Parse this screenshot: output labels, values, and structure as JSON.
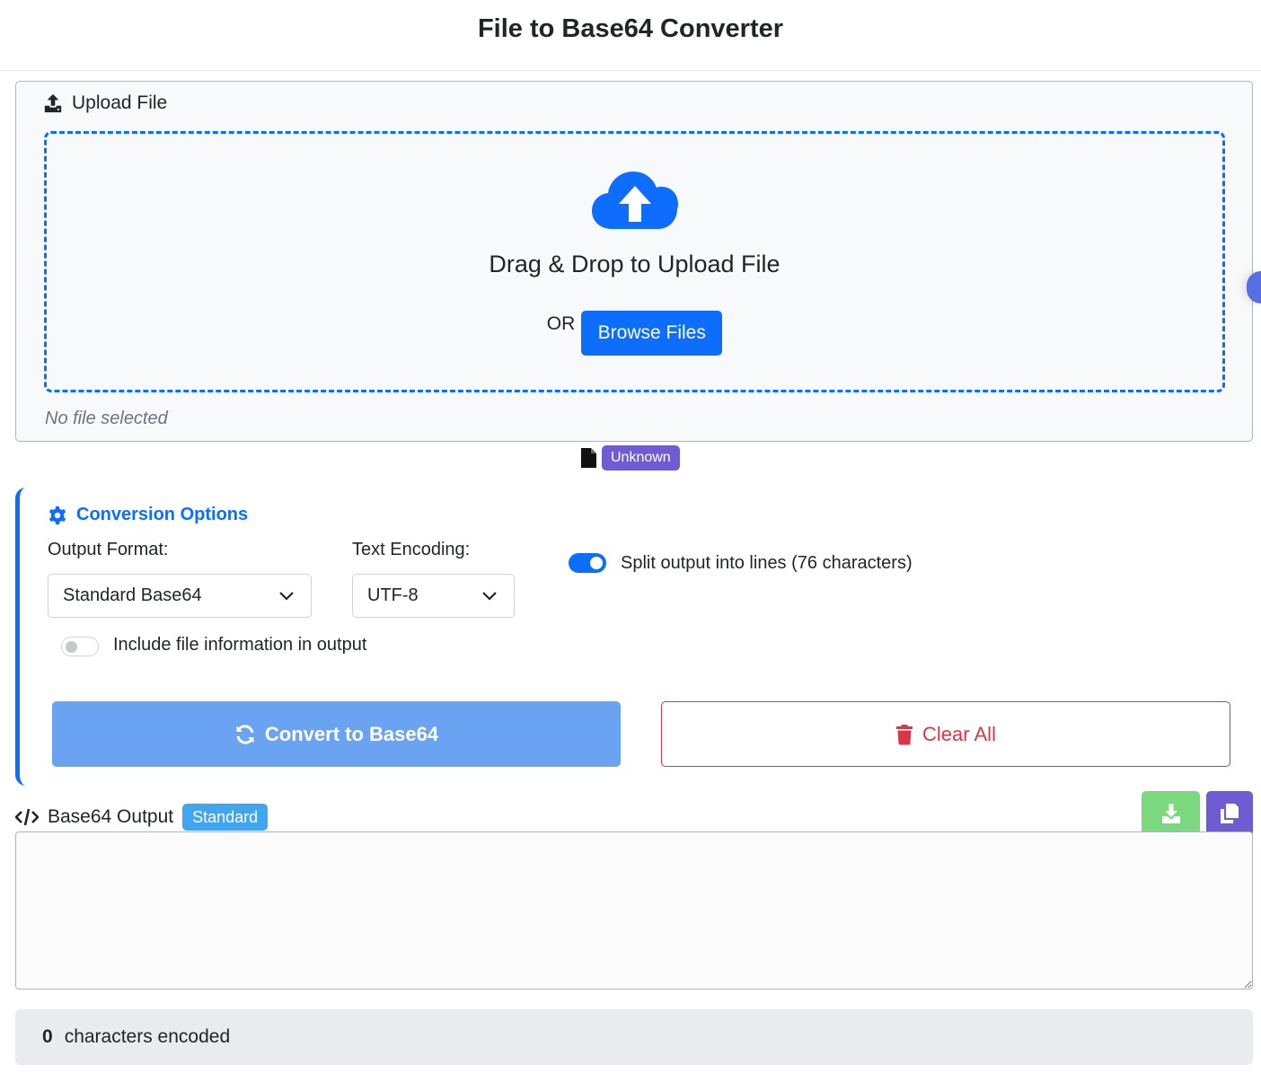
{
  "header": {
    "title": "File to Base64 Converter"
  },
  "upload": {
    "section_label": "Upload File",
    "drop_text": "Drag & Drop to Upload File",
    "or_text": "OR",
    "browse_label": "Browse Files",
    "status_text": "No file selected",
    "file_type_badge": "Unknown"
  },
  "options": {
    "title": "Conversion Options",
    "output_format_label": "Output Format:",
    "output_format_value": "Standard Base64",
    "encoding_label": "Text Encoding:",
    "encoding_value": "UTF-8",
    "split_lines_label": "Split output into lines (76 characters)",
    "split_lines_enabled": true,
    "include_info_label": "Include file information in output",
    "include_info_enabled": false,
    "convert_label": "Convert to Base64",
    "clear_label": "Clear All"
  },
  "output": {
    "label": "Base64 Output",
    "format_badge": "Standard",
    "value": ""
  },
  "stats": {
    "count": "0",
    "label": "characters encoded"
  },
  "colors": {
    "primary": "#0d6efd",
    "danger": "#dc3545",
    "success": "#7ad87f",
    "purple": "#6f5bd3",
    "info": "#3fa6ef"
  }
}
